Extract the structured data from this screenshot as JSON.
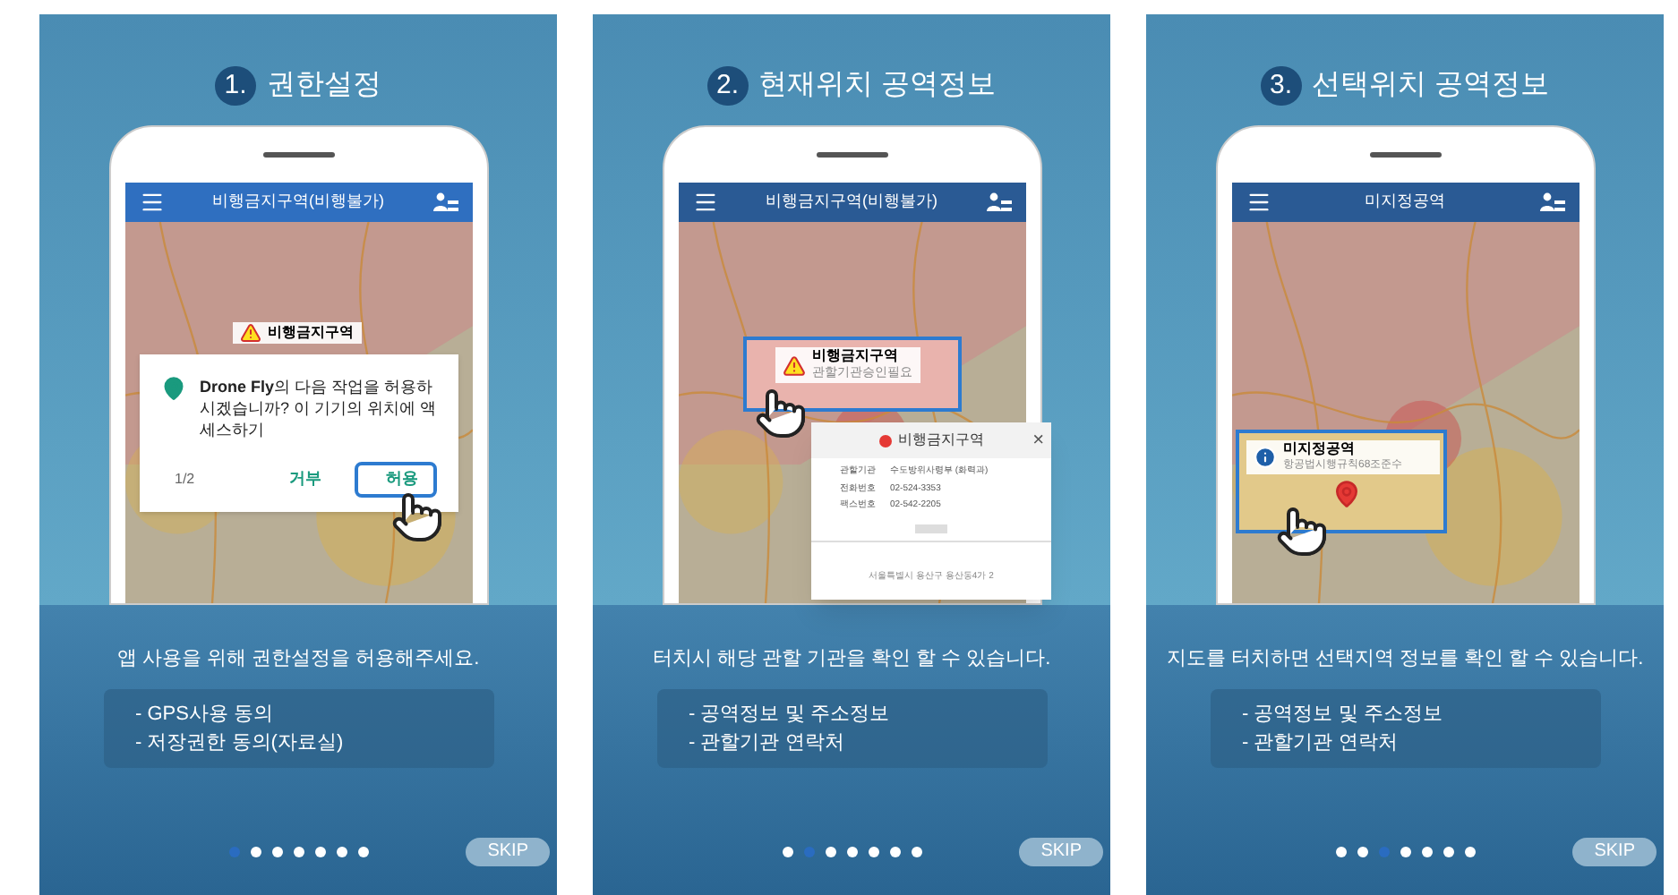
{
  "pages": [
    {
      "kind": "permission",
      "number": "1.",
      "title": "권한설정",
      "app_bar_title": "비행금지구역(비행불가)",
      "callout": {
        "title": "비행금지구역"
      },
      "dialog": {
        "message": "**Drone Fly**의 다음 작업을 허용하시겠습니까? 이 기기의 위치에 액세스하기",
        "counter": "1/2",
        "buttons": [
          {
            "label": "거부",
            "selected": false
          },
          {
            "label": "허용",
            "selected": true
          }
        ]
      },
      "description": "앱 사용을 위해 권한설정을 허용해주세요.",
      "bullets": [
        "- GPS사용 동의",
        "- 저장권한 동의(자료실)"
      ],
      "dots": [
        {
          "selected": true
        },
        {
          "selected": false
        },
        {
          "selected": false
        },
        {
          "selected": false
        },
        {
          "selected": false
        },
        {
          "selected": false
        },
        {
          "selected": false
        }
      ],
      "skip": "SKIP"
    },
    {
      "kind": "zone_detail",
      "number": "2.",
      "title": "현재위치 공역정보",
      "app_bar_title": "비행금지구역(비행불가)",
      "callout": {
        "title": "비행금지구역",
        "subtitle": "관할기관승인필요"
      },
      "card": {
        "title": "비행금지구역",
        "color": "#e53935",
        "close": "×",
        "rows": [
          {
            "label": "관할기관",
            "value": "수도방위사령부 (화력과)"
          },
          {
            "label": "전화번호",
            "value": "02-524-3353"
          },
          {
            "label": "팩스번호",
            "value": "02-542-2205"
          }
        ],
        "address": "서울특별시 용산구 용산동4가 2"
      },
      "description": "터치시 해당 관할 기관을 확인 할 수 있습니다.",
      "bullets": [
        "- 공역정보 및 주소정보",
        "- 관할기관 연락처"
      ],
      "dots": [
        {
          "selected": false
        },
        {
          "selected": true
        },
        {
          "selected": false
        },
        {
          "selected": false
        },
        {
          "selected": false
        },
        {
          "selected": false
        },
        {
          "selected": false
        }
      ],
      "skip": "SKIP"
    },
    {
      "kind": "selected_zone",
      "number": "3.",
      "title": "선택위치 공역정보",
      "app_bar_title": "미지정공역",
      "callout": {
        "title": "미지정공역",
        "subtitle": "항공법시행규칙68조준수"
      },
      "description": "지도를 터치하면 선택지역 정보를 확인 할 수 있습니다.",
      "bullets": [
        "- 공역정보 및 주소정보",
        "- 관할기관 연락처"
      ],
      "dots": [
        {
          "selected": false
        },
        {
          "selected": false
        },
        {
          "selected": true
        },
        {
          "selected": false
        },
        {
          "selected": false
        },
        {
          "selected": false
        },
        {
          "selected": false
        }
      ],
      "skip": "SKIP"
    }
  ]
}
